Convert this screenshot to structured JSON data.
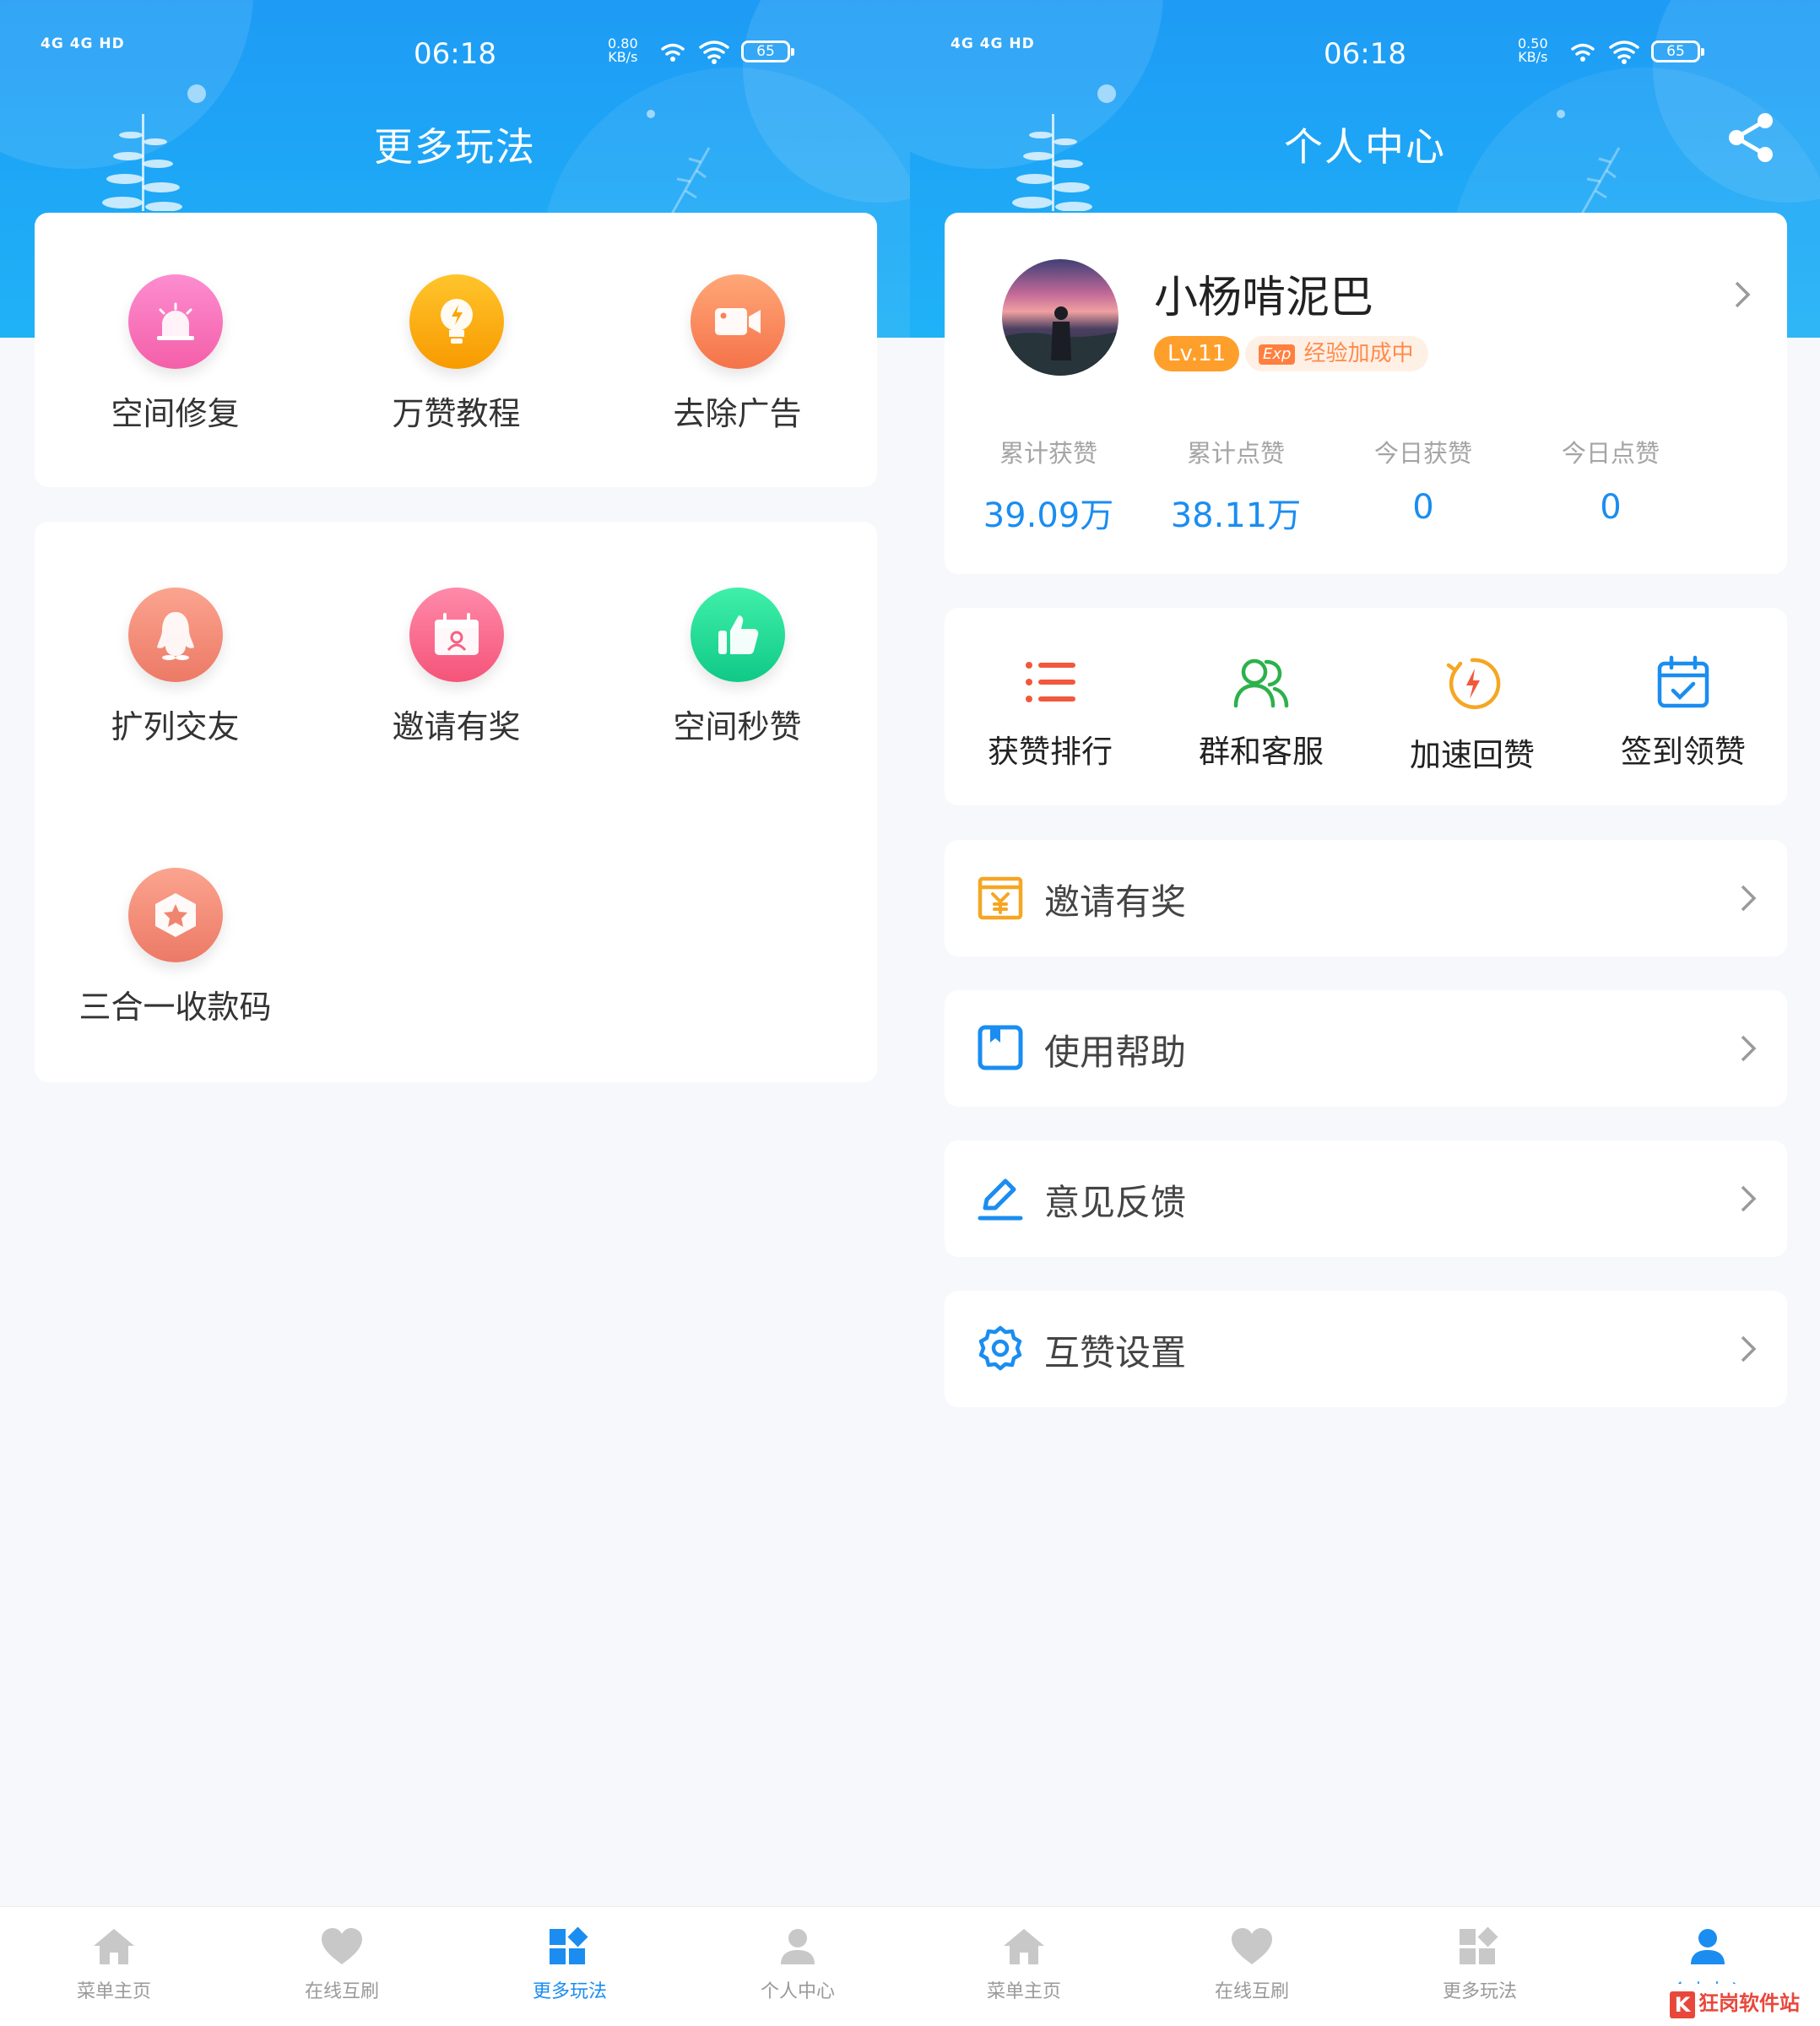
{
  "status_left": {
    "signal": "4G 4G HD",
    "time": "06:18",
    "speed_value": "0.80",
    "speed_unit": "KB/s",
    "battery": "65"
  },
  "status_right": {
    "signal": "4G 4G HD",
    "time": "06:18",
    "speed_value": "0.50",
    "speed_unit": "KB/s",
    "battery": "65"
  },
  "more": {
    "title": "更多玩法",
    "card1": [
      {
        "label": "空间修复",
        "icon": "alarm-icon",
        "color": "#f76fb8"
      },
      {
        "label": "万赞教程",
        "icon": "lightbulb-icon",
        "color": "#fbac10"
      },
      {
        "label": "去除广告",
        "icon": "video-icon",
        "color": "#f9865a"
      }
    ],
    "card2": [
      {
        "label": "扩列交友",
        "icon": "penguin-icon",
        "color": "#f08d7a"
      },
      {
        "label": "邀请有奖",
        "icon": "calendar-person-icon",
        "color": "#fb6a8d"
      },
      {
        "label": "空间秒赞",
        "icon": "thumb-up-icon",
        "color": "#1ed996"
      },
      {
        "label": "三合一收款码",
        "icon": "star-hexagon-icon",
        "color": "#f08870"
      }
    ]
  },
  "profile": {
    "title": "个人中心",
    "username": "小杨啃泥巴",
    "level": "Lv.11",
    "exp_badge": "Exp",
    "exp_text": "经验加成中",
    "stats": [
      {
        "label": "累计获赞",
        "value": "39.09万"
      },
      {
        "label": "累计点赞",
        "value": "38.11万"
      },
      {
        "label": "今日获赞",
        "value": "0"
      },
      {
        "label": "今日点赞",
        "value": "0"
      }
    ],
    "quick": [
      {
        "label": "获赞排行",
        "icon": "list-icon",
        "color": "#f2583c"
      },
      {
        "label": "群和客服",
        "icon": "group-icon",
        "color": "#2db14b"
      },
      {
        "label": "加速回赞",
        "icon": "flash-icon",
        "color": "#f5a623"
      },
      {
        "label": "签到领赞",
        "icon": "calendar-check-icon",
        "color": "#1b8df0"
      }
    ],
    "rows": [
      {
        "label": "邀请有奖",
        "icon": "gift-yen-icon",
        "color": "#f5a623"
      },
      {
        "label": "使用帮助",
        "icon": "book-icon",
        "color": "#1b8df0"
      },
      {
        "label": "意见反馈",
        "icon": "edit-icon",
        "color": "#1b8df0"
      },
      {
        "label": "互赞设置",
        "icon": "gear-icon",
        "color": "#1b8df0"
      }
    ]
  },
  "tabs": [
    {
      "label": "菜单主页",
      "icon": "home-icon"
    },
    {
      "label": "在线互刷",
      "icon": "heart-icon"
    },
    {
      "label": "更多玩法",
      "icon": "apps-icon"
    },
    {
      "label": "个人中心",
      "icon": "person-icon"
    }
  ],
  "colors": {
    "accent": "#1b8df0",
    "header_top": "#1e9bf5",
    "header_bottom": "#1fb2f7",
    "inactive_tab": "#9a9a9a"
  },
  "watermark": {
    "logo": "K",
    "text": "狂岗软件站"
  }
}
